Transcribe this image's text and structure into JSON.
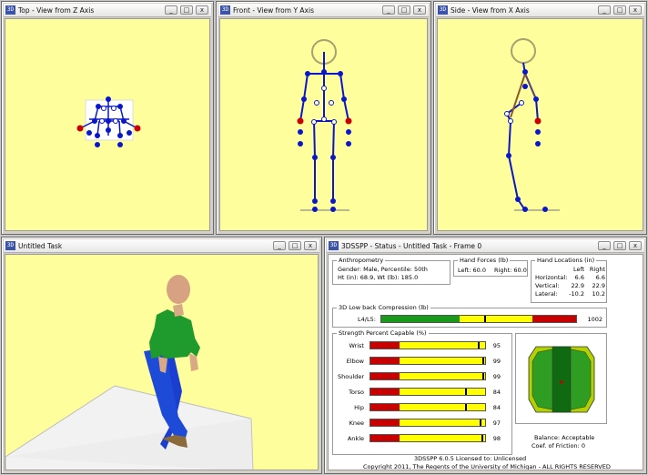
{
  "windows": {
    "top": {
      "title": "Top - View from Z Axis"
    },
    "front": {
      "title": "Front - View from Y Axis"
    },
    "side": {
      "title": "Side - View from X Axis"
    },
    "task": {
      "title": "Untitled Task"
    },
    "status": {
      "title": "3DSSPP - Status - Untitled Task - Frame 0"
    }
  },
  "controls": {
    "app_icon": "3D",
    "minimize": "_",
    "restore": "□",
    "close": "x"
  },
  "anthropometry": {
    "heading": "Anthropometry",
    "line1": "Gender: Male, Percentile: 50th",
    "line2": "Ht (in): 68.9, Wt (lb): 185.0"
  },
  "hand_forces": {
    "heading": "Hand Forces (lb)",
    "left": "Left:  60.0",
    "right": "Right:  60.0"
  },
  "hand_locations": {
    "heading": "Hand Locations (in)",
    "col_left": "Left",
    "col_right": "Right",
    "rows": [
      {
        "label": "Horizontal:",
        "left": "6.6",
        "right": "6.6"
      },
      {
        "label": "Vertical:",
        "left": "22.9",
        "right": "22.9"
      },
      {
        "label": "Lateral:",
        "left": "-10.2",
        "right": "10.2"
      }
    ]
  },
  "low_back": {
    "heading": "3D Low back Compression (lb)",
    "label": "L4/L5:",
    "value": "1002",
    "marker_fraction": 0.53
  },
  "strength": {
    "heading": "Strength Percent Capable (%)",
    "rows": [
      {
        "label": "Wrist",
        "value": "95"
      },
      {
        "label": "Elbow",
        "value": "99"
      },
      {
        "label": "Shoulder",
        "value": "99"
      },
      {
        "label": "Torso",
        "value": "84"
      },
      {
        "label": "Hip",
        "value": "84"
      },
      {
        "label": "Knee",
        "value": "97"
      },
      {
        "label": "Ankle",
        "value": "98"
      }
    ]
  },
  "balance": {
    "status": "Balance: Acceptable",
    "friction": "Coef. of Friction:  0"
  },
  "footer": {
    "line1": "3DSSPP 6.0.5 Licensed to: Unlicensed",
    "line2": "Copyright 2011, The Regents of the University of Michigan - ALL RIGHTS RESERVED"
  },
  "colors": {
    "viewport_bg": "#fefe9c",
    "joint_blue": "#0a16c8",
    "joint_red": "#c80000",
    "bar_yellow": "#ffff00",
    "bar_red": "#c80000",
    "bar_green": "#1a9a1a"
  }
}
